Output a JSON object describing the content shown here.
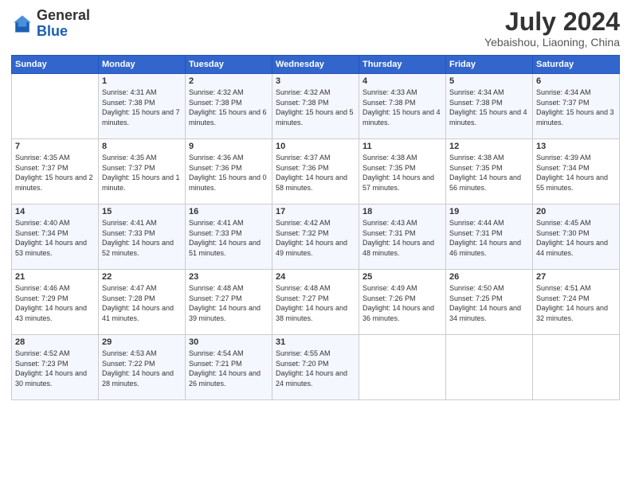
{
  "logo": {
    "general": "General",
    "blue": "Blue"
  },
  "header": {
    "month_year": "July 2024",
    "location": "Yebaishou, Liaoning, China"
  },
  "days_of_week": [
    "Sunday",
    "Monday",
    "Tuesday",
    "Wednesday",
    "Thursday",
    "Friday",
    "Saturday"
  ],
  "weeks": [
    [
      {
        "day": "",
        "sunrise": "",
        "sunset": "",
        "daylight": ""
      },
      {
        "day": "1",
        "sunrise": "Sunrise: 4:31 AM",
        "sunset": "Sunset: 7:38 PM",
        "daylight": "Daylight: 15 hours and 7 minutes."
      },
      {
        "day": "2",
        "sunrise": "Sunrise: 4:32 AM",
        "sunset": "Sunset: 7:38 PM",
        "daylight": "Daylight: 15 hours and 6 minutes."
      },
      {
        "day": "3",
        "sunrise": "Sunrise: 4:32 AM",
        "sunset": "Sunset: 7:38 PM",
        "daylight": "Daylight: 15 hours and 5 minutes."
      },
      {
        "day": "4",
        "sunrise": "Sunrise: 4:33 AM",
        "sunset": "Sunset: 7:38 PM",
        "daylight": "Daylight: 15 hours and 4 minutes."
      },
      {
        "day": "5",
        "sunrise": "Sunrise: 4:34 AM",
        "sunset": "Sunset: 7:38 PM",
        "daylight": "Daylight: 15 hours and 4 minutes."
      },
      {
        "day": "6",
        "sunrise": "Sunrise: 4:34 AM",
        "sunset": "Sunset: 7:37 PM",
        "daylight": "Daylight: 15 hours and 3 minutes."
      }
    ],
    [
      {
        "day": "7",
        "sunrise": "Sunrise: 4:35 AM",
        "sunset": "Sunset: 7:37 PM",
        "daylight": "Daylight: 15 hours and 2 minutes."
      },
      {
        "day": "8",
        "sunrise": "Sunrise: 4:35 AM",
        "sunset": "Sunset: 7:37 PM",
        "daylight": "Daylight: 15 hours and 1 minute."
      },
      {
        "day": "9",
        "sunrise": "Sunrise: 4:36 AM",
        "sunset": "Sunset: 7:36 PM",
        "daylight": "Daylight: 15 hours and 0 minutes."
      },
      {
        "day": "10",
        "sunrise": "Sunrise: 4:37 AM",
        "sunset": "Sunset: 7:36 PM",
        "daylight": "Daylight: 14 hours and 58 minutes."
      },
      {
        "day": "11",
        "sunrise": "Sunrise: 4:38 AM",
        "sunset": "Sunset: 7:35 PM",
        "daylight": "Daylight: 14 hours and 57 minutes."
      },
      {
        "day": "12",
        "sunrise": "Sunrise: 4:38 AM",
        "sunset": "Sunset: 7:35 PM",
        "daylight": "Daylight: 14 hours and 56 minutes."
      },
      {
        "day": "13",
        "sunrise": "Sunrise: 4:39 AM",
        "sunset": "Sunset: 7:34 PM",
        "daylight": "Daylight: 14 hours and 55 minutes."
      }
    ],
    [
      {
        "day": "14",
        "sunrise": "Sunrise: 4:40 AM",
        "sunset": "Sunset: 7:34 PM",
        "daylight": "Daylight: 14 hours and 53 minutes."
      },
      {
        "day": "15",
        "sunrise": "Sunrise: 4:41 AM",
        "sunset": "Sunset: 7:33 PM",
        "daylight": "Daylight: 14 hours and 52 minutes."
      },
      {
        "day": "16",
        "sunrise": "Sunrise: 4:41 AM",
        "sunset": "Sunset: 7:33 PM",
        "daylight": "Daylight: 14 hours and 51 minutes."
      },
      {
        "day": "17",
        "sunrise": "Sunrise: 4:42 AM",
        "sunset": "Sunset: 7:32 PM",
        "daylight": "Daylight: 14 hours and 49 minutes."
      },
      {
        "day": "18",
        "sunrise": "Sunrise: 4:43 AM",
        "sunset": "Sunset: 7:31 PM",
        "daylight": "Daylight: 14 hours and 48 minutes."
      },
      {
        "day": "19",
        "sunrise": "Sunrise: 4:44 AM",
        "sunset": "Sunset: 7:31 PM",
        "daylight": "Daylight: 14 hours and 46 minutes."
      },
      {
        "day": "20",
        "sunrise": "Sunrise: 4:45 AM",
        "sunset": "Sunset: 7:30 PM",
        "daylight": "Daylight: 14 hours and 44 minutes."
      }
    ],
    [
      {
        "day": "21",
        "sunrise": "Sunrise: 4:46 AM",
        "sunset": "Sunset: 7:29 PM",
        "daylight": "Daylight: 14 hours and 43 minutes."
      },
      {
        "day": "22",
        "sunrise": "Sunrise: 4:47 AM",
        "sunset": "Sunset: 7:28 PM",
        "daylight": "Daylight: 14 hours and 41 minutes."
      },
      {
        "day": "23",
        "sunrise": "Sunrise: 4:48 AM",
        "sunset": "Sunset: 7:27 PM",
        "daylight": "Daylight: 14 hours and 39 minutes."
      },
      {
        "day": "24",
        "sunrise": "Sunrise: 4:48 AM",
        "sunset": "Sunset: 7:27 PM",
        "daylight": "Daylight: 14 hours and 38 minutes."
      },
      {
        "day": "25",
        "sunrise": "Sunrise: 4:49 AM",
        "sunset": "Sunset: 7:26 PM",
        "daylight": "Daylight: 14 hours and 36 minutes."
      },
      {
        "day": "26",
        "sunrise": "Sunrise: 4:50 AM",
        "sunset": "Sunset: 7:25 PM",
        "daylight": "Daylight: 14 hours and 34 minutes."
      },
      {
        "day": "27",
        "sunrise": "Sunrise: 4:51 AM",
        "sunset": "Sunset: 7:24 PM",
        "daylight": "Daylight: 14 hours and 32 minutes."
      }
    ],
    [
      {
        "day": "28",
        "sunrise": "Sunrise: 4:52 AM",
        "sunset": "Sunset: 7:23 PM",
        "daylight": "Daylight: 14 hours and 30 minutes."
      },
      {
        "day": "29",
        "sunrise": "Sunrise: 4:53 AM",
        "sunset": "Sunset: 7:22 PM",
        "daylight": "Daylight: 14 hours and 28 minutes."
      },
      {
        "day": "30",
        "sunrise": "Sunrise: 4:54 AM",
        "sunset": "Sunset: 7:21 PM",
        "daylight": "Daylight: 14 hours and 26 minutes."
      },
      {
        "day": "31",
        "sunrise": "Sunrise: 4:55 AM",
        "sunset": "Sunset: 7:20 PM",
        "daylight": "Daylight: 14 hours and 24 minutes."
      },
      {
        "day": "",
        "sunrise": "",
        "sunset": "",
        "daylight": ""
      },
      {
        "day": "",
        "sunrise": "",
        "sunset": "",
        "daylight": ""
      },
      {
        "day": "",
        "sunrise": "",
        "sunset": "",
        "daylight": ""
      }
    ]
  ]
}
